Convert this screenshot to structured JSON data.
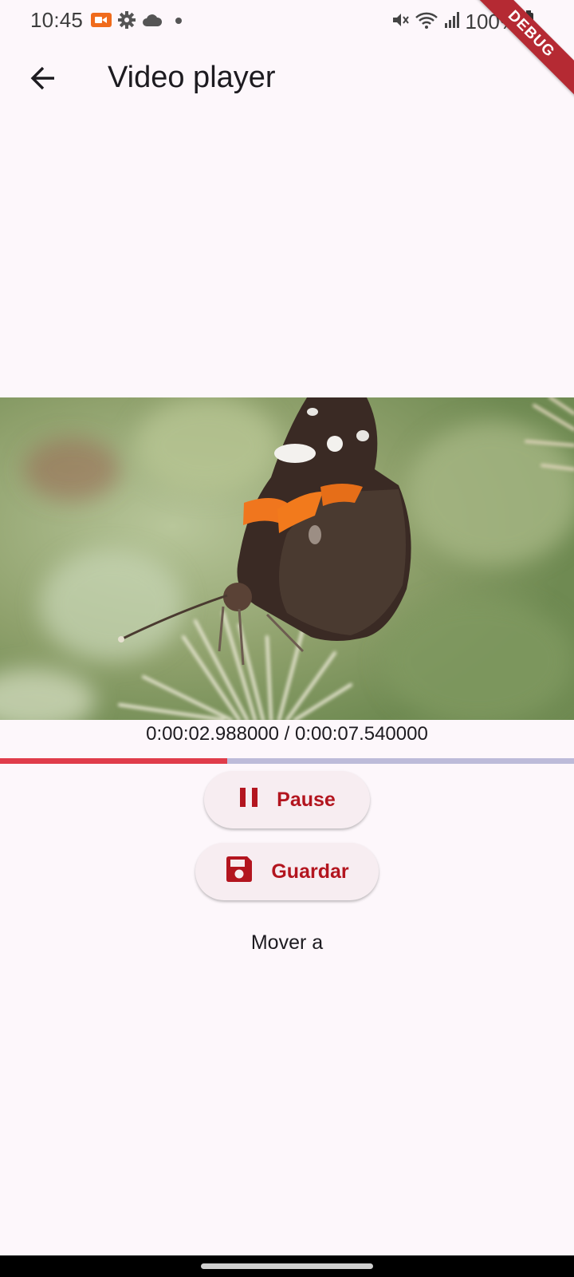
{
  "status_bar": {
    "time": "10:45",
    "battery": "100%",
    "left_icons": [
      "video-record-icon",
      "settings-icon",
      "cloud-icon",
      "dot-icon"
    ],
    "right_icons": [
      "mute-icon",
      "wifi-icon",
      "signal-icon",
      "battery-icon"
    ]
  },
  "debug_banner": "DEBUG",
  "app_bar": {
    "title": "Video player",
    "back_icon": "arrow-back-icon"
  },
  "player": {
    "position": "0:00:02.988000",
    "duration": "0:00:07.540000",
    "time_display": "0:00:02.988000 / 0:00:07.540000",
    "progress_fraction": 0.396
  },
  "controls": {
    "pause_label": "Pause",
    "pause_icon": "pause-icon",
    "save_label": "Guardar",
    "save_icon": "save-icon",
    "move_label": "Mover a"
  },
  "colors": {
    "accent": "#b3151f",
    "progress_played": "#e03c4a",
    "progress_remaining": "#bdbbd9",
    "background": "#fdf7fb"
  }
}
